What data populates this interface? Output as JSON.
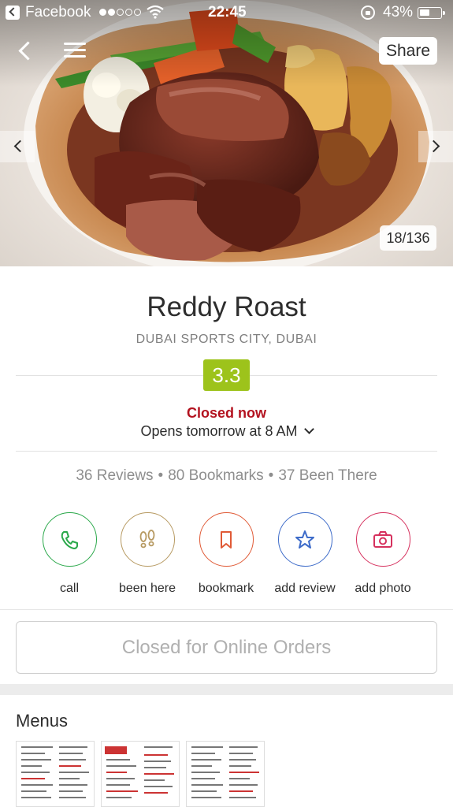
{
  "status_bar": {
    "app_name": "Facebook",
    "time": "22:45",
    "battery": "43%",
    "battery_level": 0.43,
    "signal_bars_filled": 2,
    "signal_bars_total": 5
  },
  "hero": {
    "share_label": "Share",
    "photo_counter": "18/136"
  },
  "restaurant": {
    "name": "Reddy Roast",
    "locality": "DUBAI SPORTS CITY, DUBAI",
    "rating": "3.3",
    "rating_color": "#9dc31b",
    "status": "Closed now",
    "status_color": "#b3121f",
    "opens": "Opens tomorrow at 8 AM",
    "reviews": "36 Reviews",
    "bookmarks": "80 Bookmarks",
    "been_there": "37 Been There",
    "separator": "•"
  },
  "actions": [
    {
      "label": "call",
      "icon": "phone-icon",
      "color": "#2aa84a"
    },
    {
      "label": "been here",
      "icon": "footprints-icon",
      "color": "#b79a62"
    },
    {
      "label": "bookmark",
      "icon": "bookmark-icon",
      "color": "#e05a36"
    },
    {
      "label": "add review",
      "icon": "star-icon",
      "color": "#3d6bc9"
    },
    {
      "label": "add photo",
      "icon": "camera-icon",
      "color": "#d6315e"
    }
  ],
  "online_orders_label": "Closed for Online Orders",
  "menus": {
    "title": "Menus"
  }
}
